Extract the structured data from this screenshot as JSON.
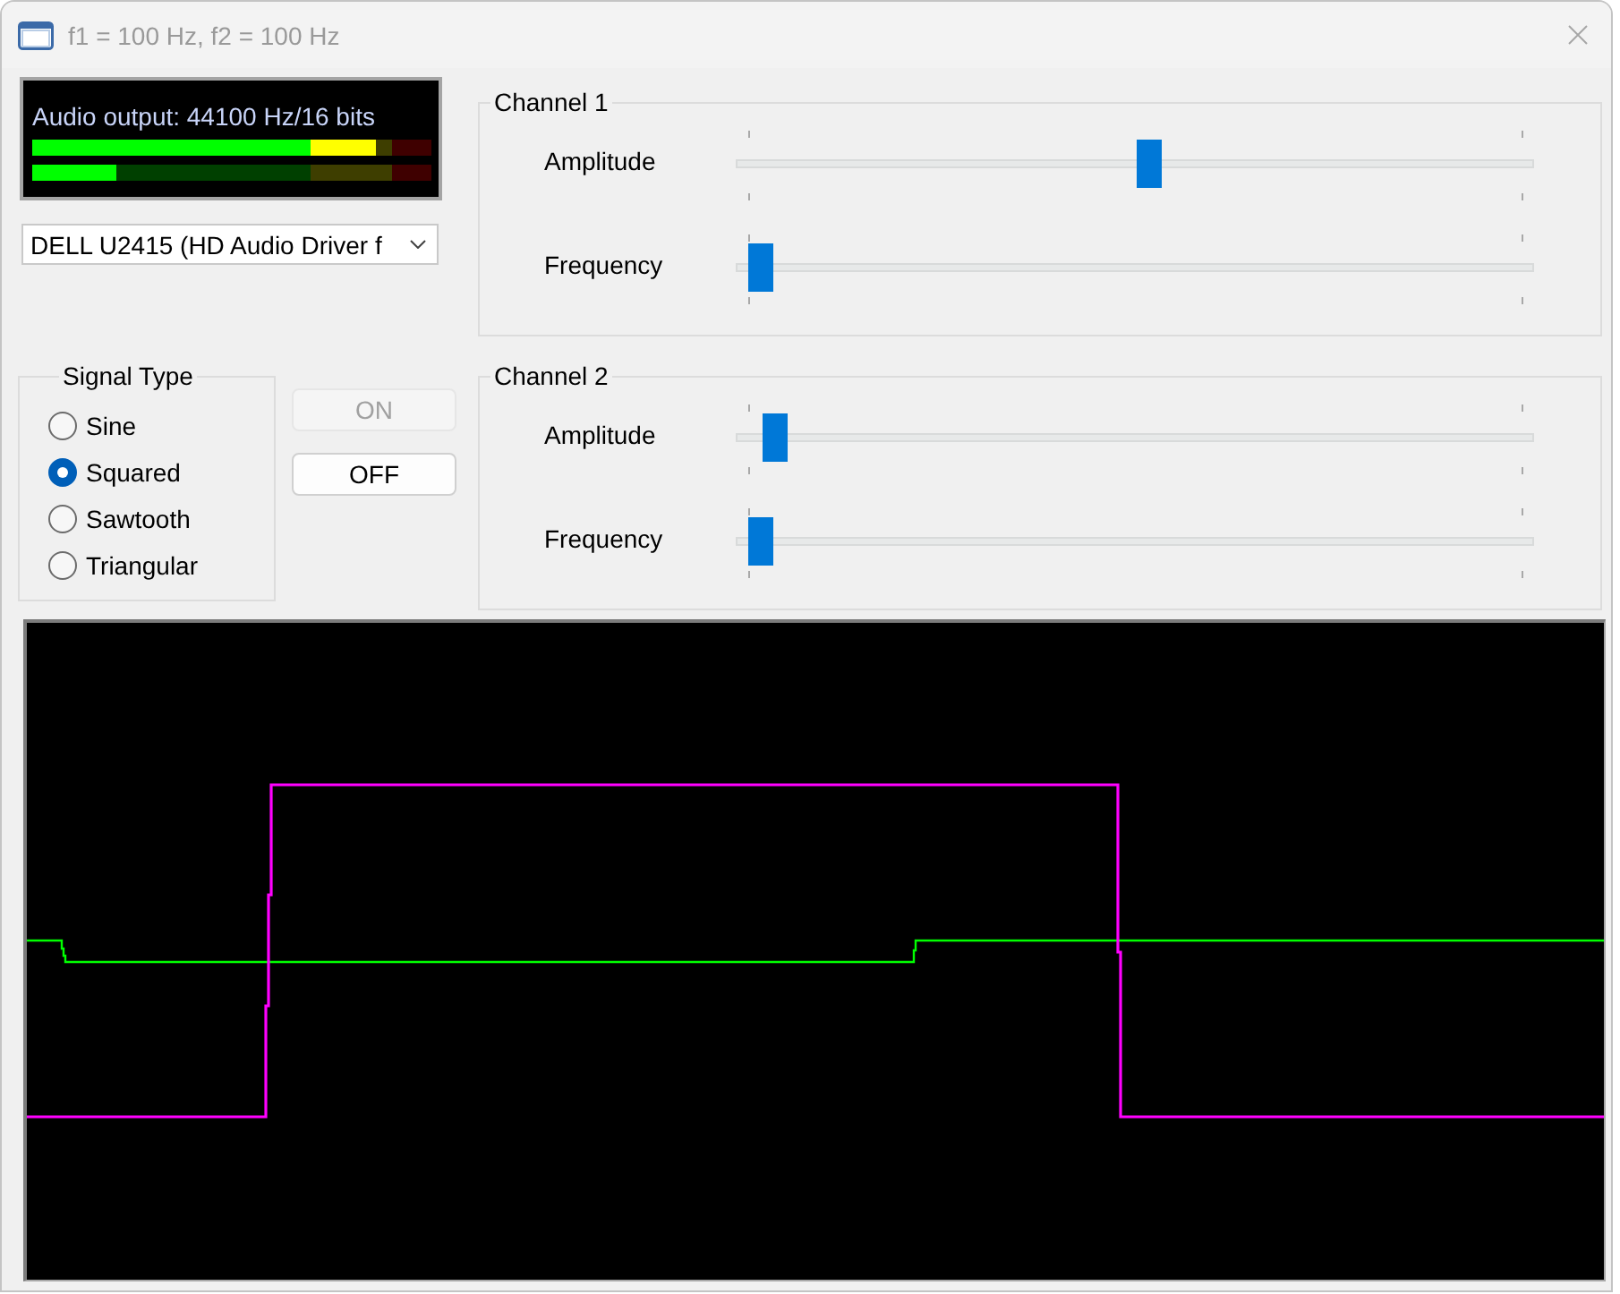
{
  "window": {
    "title": "f1 = 100 Hz, f2 = 100 Hz"
  },
  "meter": {
    "caption": "Audio output: 44100 Hz/16 bits",
    "channels": [
      {
        "level": 0.86
      },
      {
        "level": 0.21
      }
    ]
  },
  "device": {
    "value": "DELL U2415 (HD Audio Driver f"
  },
  "signal_type": {
    "title": "Signal Type",
    "options": [
      {
        "label": "Sine",
        "selected": false
      },
      {
        "label": "Squared",
        "selected": true
      },
      {
        "label": "Sawtooth",
        "selected": false
      },
      {
        "label": "Triangular",
        "selected": false
      }
    ]
  },
  "buttons": [
    {
      "label": "ON",
      "disabled": true
    },
    {
      "label": "OFF",
      "disabled": false
    }
  ],
  "channels": [
    {
      "title": "Channel 1",
      "sliders": [
        {
          "label": "Amplitude",
          "level": 0.52
        },
        {
          "label": "Frequency",
          "level": 0
        }
      ]
    },
    {
      "title": "Channel 2",
      "sliders": [
        {
          "label": "Amplitude",
          "level": 0.02
        },
        {
          "label": "Frequency",
          "level": 0
        }
      ]
    }
  ]
}
